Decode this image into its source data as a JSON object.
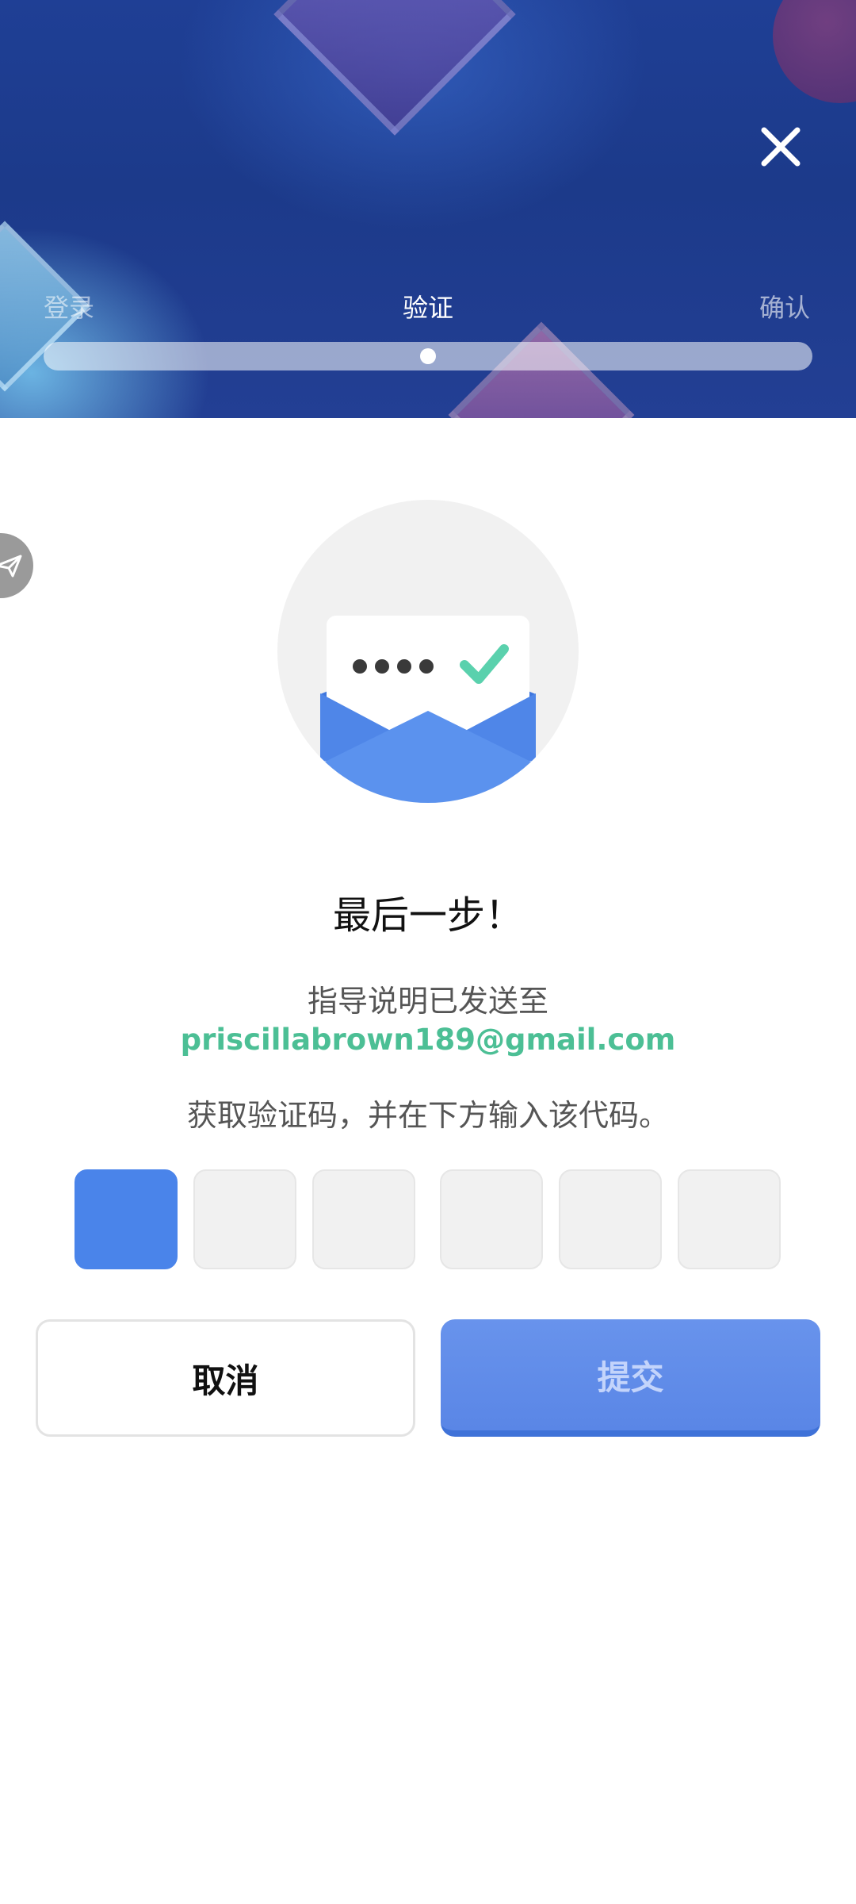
{
  "header": {
    "steps": [
      {
        "label": "登录",
        "state": "done"
      },
      {
        "label": "验证",
        "state": "current"
      },
      {
        "label": "确认",
        "state": "pending"
      }
    ],
    "progress_fraction": 0.5
  },
  "icons": {
    "close": "close-icon",
    "side": "paper-plane-icon",
    "illustration": "envelope-code-icon"
  },
  "main": {
    "title": "最后一步！",
    "subtitle": "指导说明已发送至",
    "email": "priscillabrown189@gmail.com",
    "instruction": "获取验证码，并在下方输入该代码。",
    "code_length": 6,
    "code_values": [
      "",
      "",
      "",
      "",
      "",
      ""
    ]
  },
  "buttons": {
    "cancel_label": "取消",
    "submit_label": "提交"
  },
  "colors": {
    "accent": "#4a84ea",
    "email": "#4cbf95",
    "check": "#5ad1ad"
  }
}
